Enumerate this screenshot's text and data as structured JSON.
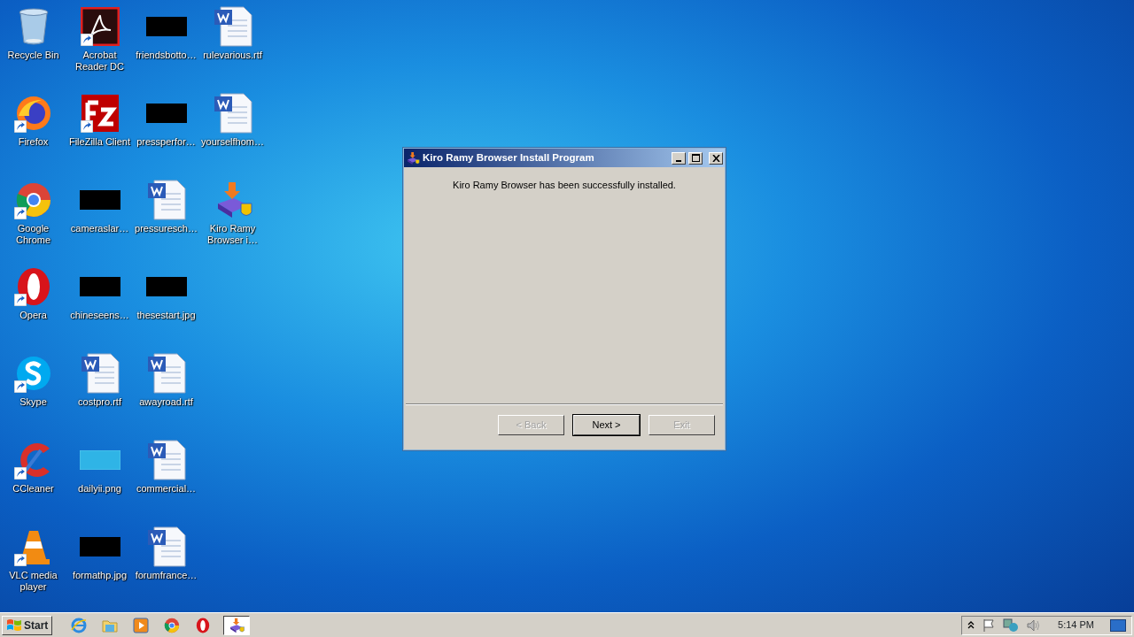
{
  "desktop_icons": [
    {
      "label": "Recycle Bin",
      "kind": "recycle",
      "shortcut": false
    },
    {
      "label": "Firefox",
      "kind": "firefox",
      "shortcut": true
    },
    {
      "label": "Google Chrome",
      "kind": "chrome",
      "shortcut": true
    },
    {
      "label": "Opera",
      "kind": "opera",
      "shortcut": true
    },
    {
      "label": "Skype",
      "kind": "skype",
      "shortcut": true
    },
    {
      "label": "CCleaner",
      "kind": "ccleaner",
      "shortcut": true
    },
    {
      "label": "VLC media player",
      "kind": "vlc",
      "shortcut": true
    },
    {
      "label": "Acrobat Reader DC",
      "kind": "acrobat",
      "shortcut": true
    },
    {
      "label": "FileZilla Client",
      "kind": "filezilla",
      "shortcut": true
    },
    {
      "label": "cameraslar…",
      "kind": "dark-thumb",
      "shortcut": false
    },
    {
      "label": "chineseens…",
      "kind": "dark-thumb",
      "shortcut": false
    },
    {
      "label": "costpro.rtf",
      "kind": "document",
      "shortcut": false
    },
    {
      "label": "dailyii.png",
      "kind": "light-thumb",
      "shortcut": false
    },
    {
      "label": "formathp.jpg",
      "kind": "dark-thumb",
      "shortcut": false
    },
    {
      "label": "friendsbotto…",
      "kind": "dark-thumb",
      "shortcut": false
    },
    {
      "label": "pressperfor…",
      "kind": "dark-thumb",
      "shortcut": false
    },
    {
      "label": "pressuresch…",
      "kind": "document",
      "shortcut": false
    },
    {
      "label": "thesestart.jpg",
      "kind": "dark-thumb",
      "shortcut": false
    },
    {
      "label": "awayroad.rtf",
      "kind": "document",
      "shortcut": false
    },
    {
      "label": "commercial…",
      "kind": "document",
      "shortcut": false
    },
    {
      "label": "forumfrance…",
      "kind": "document",
      "shortcut": false
    },
    {
      "label": "rulevarious.rtf",
      "kind": "document",
      "shortcut": false
    },
    {
      "label": "yourselfhom…",
      "kind": "document",
      "shortcut": false
    },
    {
      "label": "Kiro Ramy Browser i…",
      "kind": "installer",
      "shortcut": false
    }
  ],
  "dialog": {
    "title": "Kiro Ramy Browser Install Program",
    "message": "Kiro Ramy Browser has been successfully installed.",
    "buttons": [
      {
        "label": "< Back",
        "disabled": true,
        "default": false
      },
      {
        "label": "Next >",
        "disabled": false,
        "default": true
      },
      {
        "label": "Exit",
        "disabled": true,
        "default": false
      }
    ]
  },
  "taskbar": {
    "start_label": "Start",
    "apps": [
      {
        "kind": "ie",
        "active": false
      },
      {
        "kind": "folder",
        "active": false
      },
      {
        "kind": "media",
        "active": false
      },
      {
        "kind": "chrome",
        "active": false
      },
      {
        "kind": "opera",
        "active": false
      },
      {
        "kind": "installer",
        "active": true
      }
    ],
    "clock": "5:14 PM"
  }
}
